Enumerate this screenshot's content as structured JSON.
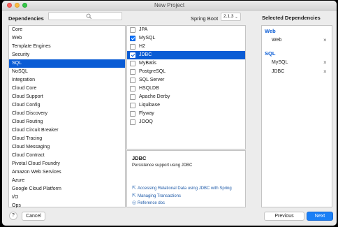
{
  "window": {
    "title": "New Project"
  },
  "header": {
    "dependencies_label": "Dependencies",
    "search_placeholder": "",
    "spring_boot_label": "Spring Boot",
    "spring_boot_version": "2.1.3"
  },
  "categories": [
    {
      "label": "Core",
      "selected": false
    },
    {
      "label": "Web",
      "selected": false
    },
    {
      "label": "Template Engines",
      "selected": false
    },
    {
      "label": "Security",
      "selected": false
    },
    {
      "label": "SQL",
      "selected": true
    },
    {
      "label": "NoSQL",
      "selected": false
    },
    {
      "label": "Integration",
      "selected": false
    },
    {
      "label": "Cloud Core",
      "selected": false
    },
    {
      "label": "Cloud Support",
      "selected": false
    },
    {
      "label": "Cloud Config",
      "selected": false
    },
    {
      "label": "Cloud Discovery",
      "selected": false
    },
    {
      "label": "Cloud Routing",
      "selected": false
    },
    {
      "label": "Cloud Circuit Breaker",
      "selected": false
    },
    {
      "label": "Cloud Tracing",
      "selected": false
    },
    {
      "label": "Cloud Messaging",
      "selected": false
    },
    {
      "label": "Cloud Contract",
      "selected": false
    },
    {
      "label": "Pivotal Cloud Foundry",
      "selected": false
    },
    {
      "label": "Amazon Web Services",
      "selected": false
    },
    {
      "label": "Azure",
      "selected": false
    },
    {
      "label": "Google Cloud Platform",
      "selected": false
    },
    {
      "label": "I/O",
      "selected": false
    },
    {
      "label": "Ops",
      "selected": false
    }
  ],
  "dependencies": [
    {
      "label": "JPA",
      "checked": false,
      "selected": false
    },
    {
      "label": "MySQL",
      "checked": true,
      "selected": false
    },
    {
      "label": "H2",
      "checked": false,
      "selected": false
    },
    {
      "label": "JDBC",
      "checked": true,
      "selected": true
    },
    {
      "label": "MyBatis",
      "checked": false,
      "selected": false
    },
    {
      "label": "PostgreSQL",
      "checked": false,
      "selected": false
    },
    {
      "label": "SQL Server",
      "checked": false,
      "selected": false
    },
    {
      "label": "HSQLDB",
      "checked": false,
      "selected": false
    },
    {
      "label": "Apache Derby",
      "checked": false,
      "selected": false
    },
    {
      "label": "Liquibase",
      "checked": false,
      "selected": false
    },
    {
      "label": "Flyway",
      "checked": false,
      "selected": false
    },
    {
      "label": "JOOQ",
      "checked": false,
      "selected": false
    }
  ],
  "description": {
    "title": "JDBC",
    "text": "Persistence support using JDBC",
    "links": [
      {
        "label": "Accessing Relational Data using JDBC with Spring",
        "icon": "guide-icon"
      },
      {
        "label": "Managing Transactions",
        "icon": "guide-icon"
      },
      {
        "label": "Reference doc",
        "icon": "reference-icon"
      }
    ]
  },
  "selected": {
    "header": "Selected Dependencies",
    "groups": [
      {
        "name": "Web",
        "items": [
          "Web"
        ]
      },
      {
        "name": "SQL",
        "items": [
          "MySQL",
          "JDBC"
        ]
      }
    ]
  },
  "footer": {
    "help": "?",
    "cancel": "Cancel",
    "previous": "Previous",
    "next": "Next"
  },
  "colors": {
    "accent": "#0a5cd5",
    "primary_button": "#1a7ff6"
  }
}
